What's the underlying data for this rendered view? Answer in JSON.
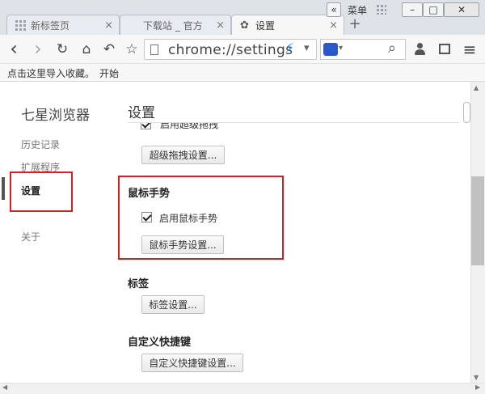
{
  "window": {
    "menu_label": "菜单",
    "chevron": "«",
    "minimize": "–",
    "maximize": "□",
    "close": "✕"
  },
  "tabs": [
    {
      "label": "新标签页",
      "close": "×"
    },
    {
      "label": "下载站 _ 官方",
      "close": "×"
    },
    {
      "label": "设置",
      "close": "×"
    }
  ],
  "toolbar": {
    "url": "chrome://settings",
    "back": "‹",
    "forward": "›",
    "reload": "↻",
    "home": "⌂",
    "undo": "↶",
    "star": "☆",
    "lightning": "⚡",
    "dropdown": "▾",
    "search_icon": "⌕",
    "menu": "≡"
  },
  "bookmarks": {
    "import": "点击这里导入收藏。",
    "start": "开始"
  },
  "sidebar": {
    "title": "七星浏览器",
    "items": [
      {
        "label": "历史记录"
      },
      {
        "label": "扩展程序"
      },
      {
        "label": "设置"
      },
      {
        "label": "关于"
      }
    ]
  },
  "main": {
    "title": "设置",
    "sections": {
      "drag": {
        "checkbox_label": "启用超级拖拽",
        "button": "超级拖拽设置..."
      },
      "gesture": {
        "title": "鼠标手势",
        "checkbox_label": "启用鼠标手势",
        "button": "鼠标手势设置..."
      },
      "tabs": {
        "title": "标签",
        "button": "标签设置..."
      },
      "shortcuts": {
        "title": "自定义快捷键",
        "button": "自定义快捷键设置..."
      }
    }
  },
  "colors": {
    "highlight": "#d62020",
    "search_engine": "#2d56c9",
    "lightning": "#2a7be4"
  }
}
